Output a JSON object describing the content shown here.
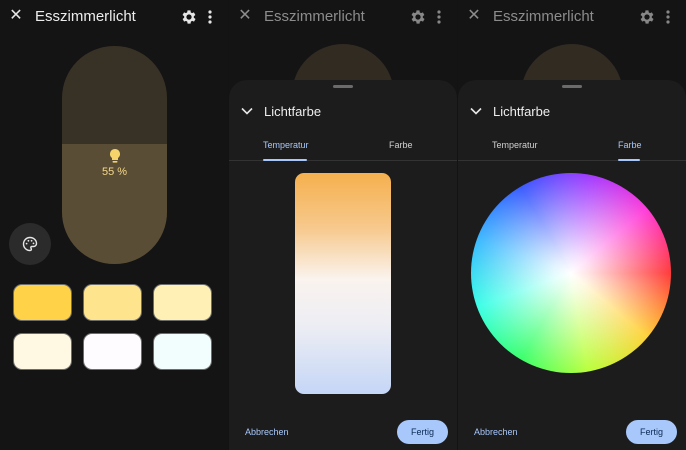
{
  "device_title": "Esszimmerlicht",
  "brightness": {
    "value_label": "55 %",
    "fraction": 0.55
  },
  "swatches": [
    {
      "color": "#ffd248"
    },
    {
      "color": "#ffe48e"
    },
    {
      "color": "#fff1b5"
    },
    {
      "color": "#fff8e2"
    },
    {
      "color": "#fefcfe"
    },
    {
      "color": "#f2fdfd"
    }
  ],
  "sheet": {
    "title": "Lichtfarbe",
    "tabs": [
      "Temperatur",
      "Farbe"
    ],
    "cancel_label": "Abbrechen",
    "done_label": "Fertig"
  },
  "icons": {
    "close": "close-icon",
    "settings": "gear-icon",
    "more": "more-vert-icon",
    "palette": "palette-icon",
    "bulb": "lightbulb-icon",
    "collapse": "chevron-down-icon"
  },
  "colors": {
    "accent": "#a8c7fa",
    "brightness_fill": "#5a4d36",
    "brightness_track": "#383125"
  }
}
